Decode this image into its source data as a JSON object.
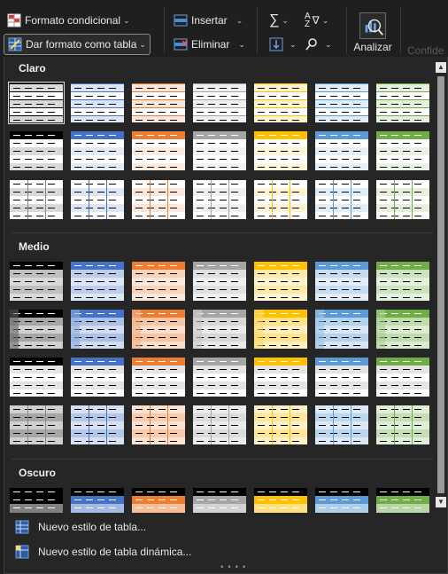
{
  "ribbon": {
    "formato_condicional": "Formato condicional",
    "dar_formato": "Dar formato como tabla",
    "insertar": "Insertar",
    "eliminar": "Eliminar",
    "analizar": "Analizar",
    "confide": "Confide"
  },
  "sections": [
    {
      "label": "Claro"
    },
    {
      "label": "Medio"
    },
    {
      "label": "Oscuro"
    }
  ],
  "palette": {
    "black": "#000000",
    "blue": "#4472c4",
    "orange": "#ed7d31",
    "gray": "#a5a5a5",
    "gold": "#ffc000",
    "lightblue": "#5b9bd5",
    "green": "#70ad47"
  },
  "menu": {
    "nuevo_estilo_tabla": "Nuevo estilo de tabla...",
    "nuevo_estilo_dinamica": "Nuevo estilo de tabla dinámica..."
  },
  "colors": {
    "background": "#1f1f1f",
    "panel": "#262626",
    "text": "#e8e8e8"
  }
}
